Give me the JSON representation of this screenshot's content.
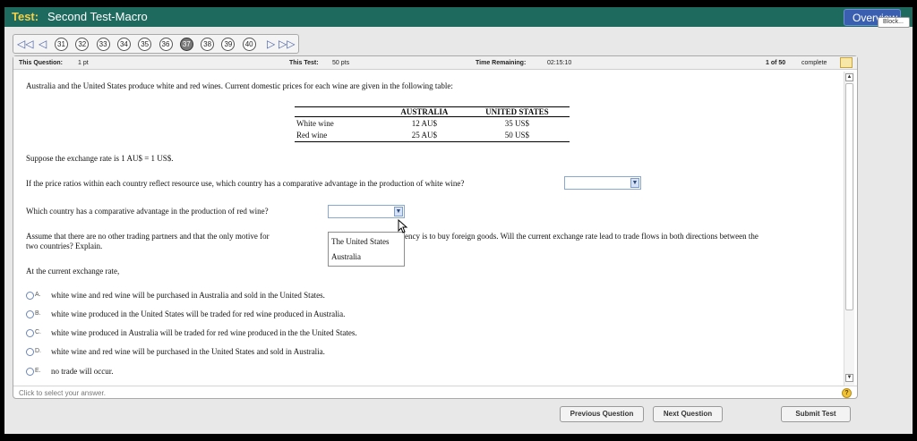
{
  "titlebar": {
    "prefix": "Test:",
    "name": "Second Test-Macro",
    "overview_label": "Overview",
    "tooltip": "Block..."
  },
  "nav": {
    "first_icon": "first-page-icon",
    "prev_icon": "previous-icon",
    "next_icon": "next-icon",
    "last_icon": "last-page-icon",
    "questions": [
      "31",
      "32",
      "33",
      "34",
      "35",
      "36",
      "37",
      "38",
      "39",
      "40"
    ],
    "current": "37"
  },
  "info": {
    "question_label": "This Question:",
    "question_value": "1 pt",
    "test_label": "This Test:",
    "test_value": "50 pts",
    "time_label": "Time Remaining:",
    "time_value": "02:15:10",
    "progress": "1 of 50",
    "progress_suffix": "complete"
  },
  "question": {
    "intro": "Australia and the United States produce white and red wines.  Current domestic prices for each wine are given  in the following table:",
    "table": {
      "headers": [
        "",
        "AUSTRALIA",
        "UNITED STATES"
      ],
      "rows": [
        [
          "White wine",
          "12 AU$",
          "35 US$"
        ],
        [
          "Red wine",
          "25 AU$",
          "50 US$"
        ]
      ]
    },
    "exchange_rate": "Suppose the exchange rate is 1 AU$ = 1 US$.",
    "q1": "If the price ratios within each country reflect resource use, which country has a comparative advantage in the production of white wine?",
    "q2": "Which country has a comparative advantage in the production of red wine?",
    "q3_part1": "Assume that there are no other trading partners and that the only motive for",
    "q3_part2": "ency  is to buy foreign goods.  Will the current exchange rate lead to trade flows in both directions between the",
    "q3_part3": "two countries?  Explain.",
    "lead_in": "At the current exchange rate,",
    "dropdown_options": [
      "The United States",
      "Australia"
    ],
    "choices": [
      {
        "letter": "A.",
        "text": "white wine and red wine will be purchased in Australia and sold in the United States."
      },
      {
        "letter": "B.",
        "text": "white wine produced in the United States will be traded for red wine produced in Australia."
      },
      {
        "letter": "C.",
        "text": "white wine produced in Australia will be traded for red wine produced in the the United States."
      },
      {
        "letter": "D.",
        "text": "white wine and red wine will be purchased in the United States and sold in Australia."
      },
      {
        "letter": "E.",
        "text": "no trade will occur."
      }
    ]
  },
  "footer": {
    "hint": "Click to select your answer.",
    "help_icon": "help-icon"
  },
  "buttons": {
    "previous": "Previous Question",
    "next": "Next Question",
    "submit": "Submit Test"
  },
  "colors": {
    "titlebar": "#1e6a5f",
    "prefix": "#f2d04a",
    "overview": "#3b5fb0"
  }
}
